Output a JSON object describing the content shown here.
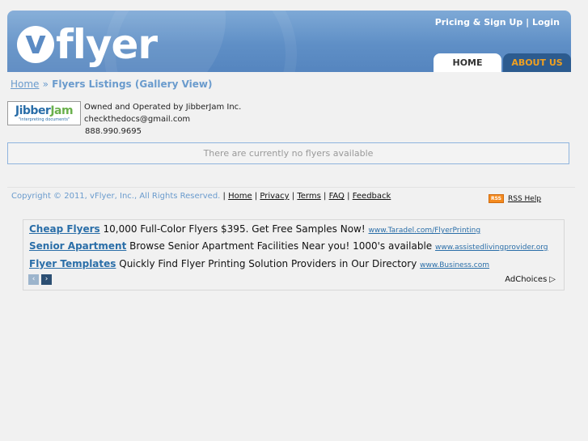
{
  "header": {
    "logo_v": "v",
    "logo_text": "flyer",
    "pricing_link": "Pricing & Sign Up",
    "link_sep": "|",
    "login_link": "Login",
    "tabs": [
      {
        "label": "HOME"
      },
      {
        "label": "ABOUT US"
      }
    ]
  },
  "breadcrumb": {
    "home": "Home",
    "sep": "»",
    "current": "Flyers Listings (Gallery View)"
  },
  "owner": {
    "logo_brand_a": "Jibber",
    "logo_brand_b": "Jam",
    "logo_tagline": "\"interpreting documents\"",
    "operated_by": "Owned and Operated by JibberJam Inc.",
    "email": "checkthedocs@gmail.com",
    "phone": "888.990.9695"
  },
  "notice": "There are currently no flyers available",
  "footer": {
    "copyright": "Copyright © 2011, vFlyer, Inc., All Rights Reserved.",
    "links": [
      "Home",
      "Privacy",
      "Terms",
      "FAQ",
      "Feedback"
    ],
    "rss_badge": "RSS",
    "rss_help": "RSS Help"
  },
  "ads": {
    "items": [
      {
        "title": "Cheap Flyers",
        "text": "10,000 Full-Color Flyers $395. Get Free Samples Now!",
        "url": "www.Taradel.com/FlyerPrinting"
      },
      {
        "title": "Senior Apartment",
        "text": "Browse Senior Apartment Facilities Near you! 1000's available",
        "url": "www.assistedlivingprovider.org"
      },
      {
        "title": "Flyer Templates",
        "text": "Quickly Find Flyer Printing Solution Providers in Our Directory",
        "url": "www.Business.com"
      }
    ],
    "adchoices": "AdChoices",
    "prev_icon": "‹",
    "next_icon": "›"
  },
  "colors": {
    "header_blue": "#5f8fc6",
    "about_tab": "#2c5b8f",
    "about_text": "#f0a020",
    "link_blue": "#6a9bcd",
    "ad_title": "#2a6ea8"
  }
}
